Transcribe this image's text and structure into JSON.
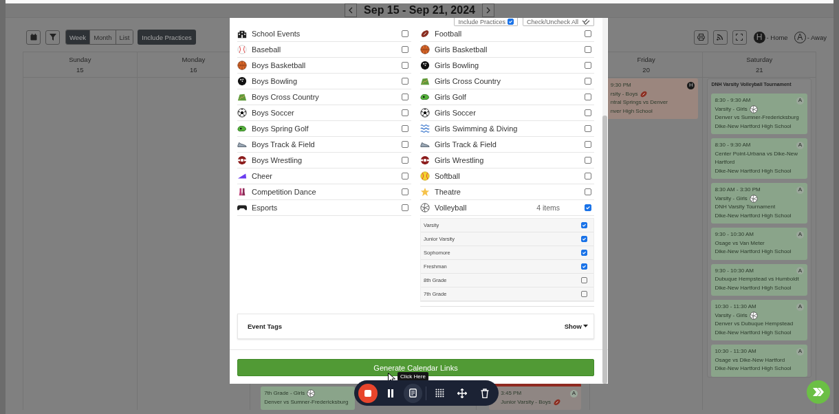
{
  "header": {
    "title": "Sep 15 - Sep 21, 2024"
  },
  "toolbar": {
    "views": [
      {
        "label": "Week",
        "selected": true
      },
      {
        "label": "Month",
        "selected": false
      },
      {
        "label": "List",
        "selected": false
      }
    ],
    "include_practices": "Include Practices"
  },
  "legend": [
    {
      "kind": "home",
      "badge": "H",
      "label": "- Home"
    },
    {
      "kind": "away",
      "badge": "A",
      "label": "- Away"
    }
  ],
  "calendar": {
    "days": [
      {
        "name": "Sunday",
        "date": "15"
      },
      {
        "name": "Monday",
        "date": "16"
      },
      {
        "events": [
          {
            "team": "7th Grade - Girls",
            "team_icon": {
              "kind": "volleyball"
            },
            "matchup": "Denver vs Sumner-Fredericksburg",
            "color": "#8aa48a"
          }
        ]
      },
      {
        "events": [
          {
            "time": "3:45 PM",
            "badge": {
              "text": "A",
              "kind": "away"
            },
            "team": "Junior Varsity - Boys",
            "team_icon": {
              "kind": "football"
            },
            "color": "#8f8683",
            "flag": true
          }
        ]
      },
      {
        "name": "Friday",
        "date": "20",
        "events": [
          {
            "time": "9:30 PM",
            "badge": {
              "text": "H",
              "kind": "home"
            },
            "team": "rsity - Boys",
            "team_icon": {
              "kind": "football"
            },
            "matchup": "ntral Springs vs Denver",
            "location": "nver High School",
            "color": "#9b867e"
          }
        ]
      },
      {
        "name": "Saturday",
        "date": "21",
        "group": "DNH Varsity Volleyball Tournament",
        "events": [
          {
            "time": "8:30 - 9:30 AM",
            "badge": {
              "text": "A",
              "kind": "away"
            },
            "team": "Varsity - Girls",
            "team_icon": {
              "kind": "volleyball"
            },
            "matchup": "Denver vs Sumner-Fredericksburg",
            "location": "Dike-New Hartford High School",
            "color": "#8aa48a"
          },
          {
            "time": "8:30 - 9:30 AM",
            "badge": {
              "text": "A",
              "kind": "away"
            },
            "matchup": "Center Point-Urbana vs Dike-New Hartford",
            "location": "Dike-New Hartford High School",
            "color": "#8aa48a"
          },
          {
            "time": "8:30 AM - 3:30 PM",
            "badge": {
              "text": "A",
              "kind": "away"
            },
            "team": "Varsity - Girls",
            "team_icon": {
              "kind": "volleyball"
            },
            "matchup": "DNH Varsity Tournament",
            "location": "Dike-New Hartford High School",
            "color": "#8aa48a"
          },
          {
            "time": "9:30 - 10:30 AM",
            "badge": {
              "text": "A",
              "kind": "away"
            },
            "matchup": "Osage vs Van Meter",
            "location": "Dike-New Hartford High School",
            "color": "#8aa48a"
          },
          {
            "time": "9:30 - 10:30 AM",
            "badge": {
              "text": "A",
              "kind": "away"
            },
            "matchup": "Dubuque Hempstead vs Humboldt",
            "location": "Dike-New Hartford High School",
            "color": "#8aa48a"
          },
          {
            "time": "10:30 - 11:30 AM",
            "badge": {
              "text": "A",
              "kind": "away"
            },
            "team": "Varsity - Girls",
            "team_icon": {
              "kind": "volleyball"
            },
            "matchup": "Denver vs Dubuque Hempstead",
            "location": "Dike-New Hartford High School",
            "color": "#8aa48a"
          },
          {
            "time": "10:30 - 11:30 AM",
            "badge": {
              "text": "A",
              "kind": "away"
            },
            "matchup": "Osage vs Dike-New Hartford",
            "location": "Dike-New Hartford High School",
            "color": "#8aa48a"
          }
        ]
      }
    ]
  },
  "modal": {
    "include_practices": {
      "label": "Include Practices",
      "checked": true
    },
    "check_all": {
      "label": "Check/Uncheck All"
    },
    "left": [
      {
        "label": "School Events",
        "kind": "building",
        "checked": false
      },
      {
        "label": "Baseball",
        "kind": "baseball",
        "checked": false
      },
      {
        "label": "Boys Basketball",
        "kind": "basketball",
        "checked": false
      },
      {
        "label": "Boys Bowling",
        "kind": "bowling",
        "checked": false
      },
      {
        "label": "Boys Cross Country",
        "kind": "field",
        "checked": false
      },
      {
        "label": "Boys Soccer",
        "kind": "soccer",
        "checked": false
      },
      {
        "label": "Boys Spring Golf",
        "kind": "golf",
        "checked": false
      },
      {
        "label": "Boys Track & Field",
        "kind": "shoe",
        "checked": false
      },
      {
        "label": "Boys Wrestling",
        "kind": "wrestling",
        "checked": false
      },
      {
        "label": "Cheer",
        "kind": "megaphone",
        "checked": false
      },
      {
        "label": "Competition Dance",
        "kind": "dancers",
        "checked": false
      },
      {
        "label": "Esports",
        "kind": "gamepad",
        "checked": false
      }
    ],
    "right": [
      {
        "label": "Football",
        "kind": "football",
        "checked": false
      },
      {
        "label": "Girls Basketball",
        "kind": "basketball",
        "checked": false
      },
      {
        "label": "Girls Bowling",
        "kind": "bowling",
        "checked": false
      },
      {
        "label": "Girls Cross Country",
        "kind": "field",
        "checked": false
      },
      {
        "label": "Girls Golf",
        "kind": "golf",
        "checked": false
      },
      {
        "label": "Girls Soccer",
        "kind": "soccer",
        "checked": false
      },
      {
        "label": "Girls Swimming & Diving",
        "kind": "waves",
        "checked": false
      },
      {
        "label": "Girls Track & Field",
        "kind": "shoe",
        "checked": false
      },
      {
        "label": "Girls Wrestling",
        "kind": "wrestling",
        "checked": false
      },
      {
        "label": "Softball",
        "kind": "softball",
        "checked": false
      },
      {
        "label": "Theatre",
        "kind": "star",
        "checked": false
      },
      {
        "label": "Volleyball",
        "kind": "volleyball",
        "count": "4 items",
        "checked": true,
        "subitems": [
          {
            "label": "Varsity",
            "checked": true
          },
          {
            "label": "Junior Varsity",
            "checked": true
          },
          {
            "label": "Sophomore",
            "checked": true
          },
          {
            "label": "Freshman",
            "checked": true
          },
          {
            "label": "8th Grade",
            "checked": false
          },
          {
            "label": "7th Grade",
            "checked": false
          }
        ]
      }
    ],
    "event_tags": {
      "label": "Event Tags",
      "toggle": "Show"
    },
    "generate": "Generate Calendar Links"
  },
  "recorder": {
    "tooltip": "Click Here"
  }
}
